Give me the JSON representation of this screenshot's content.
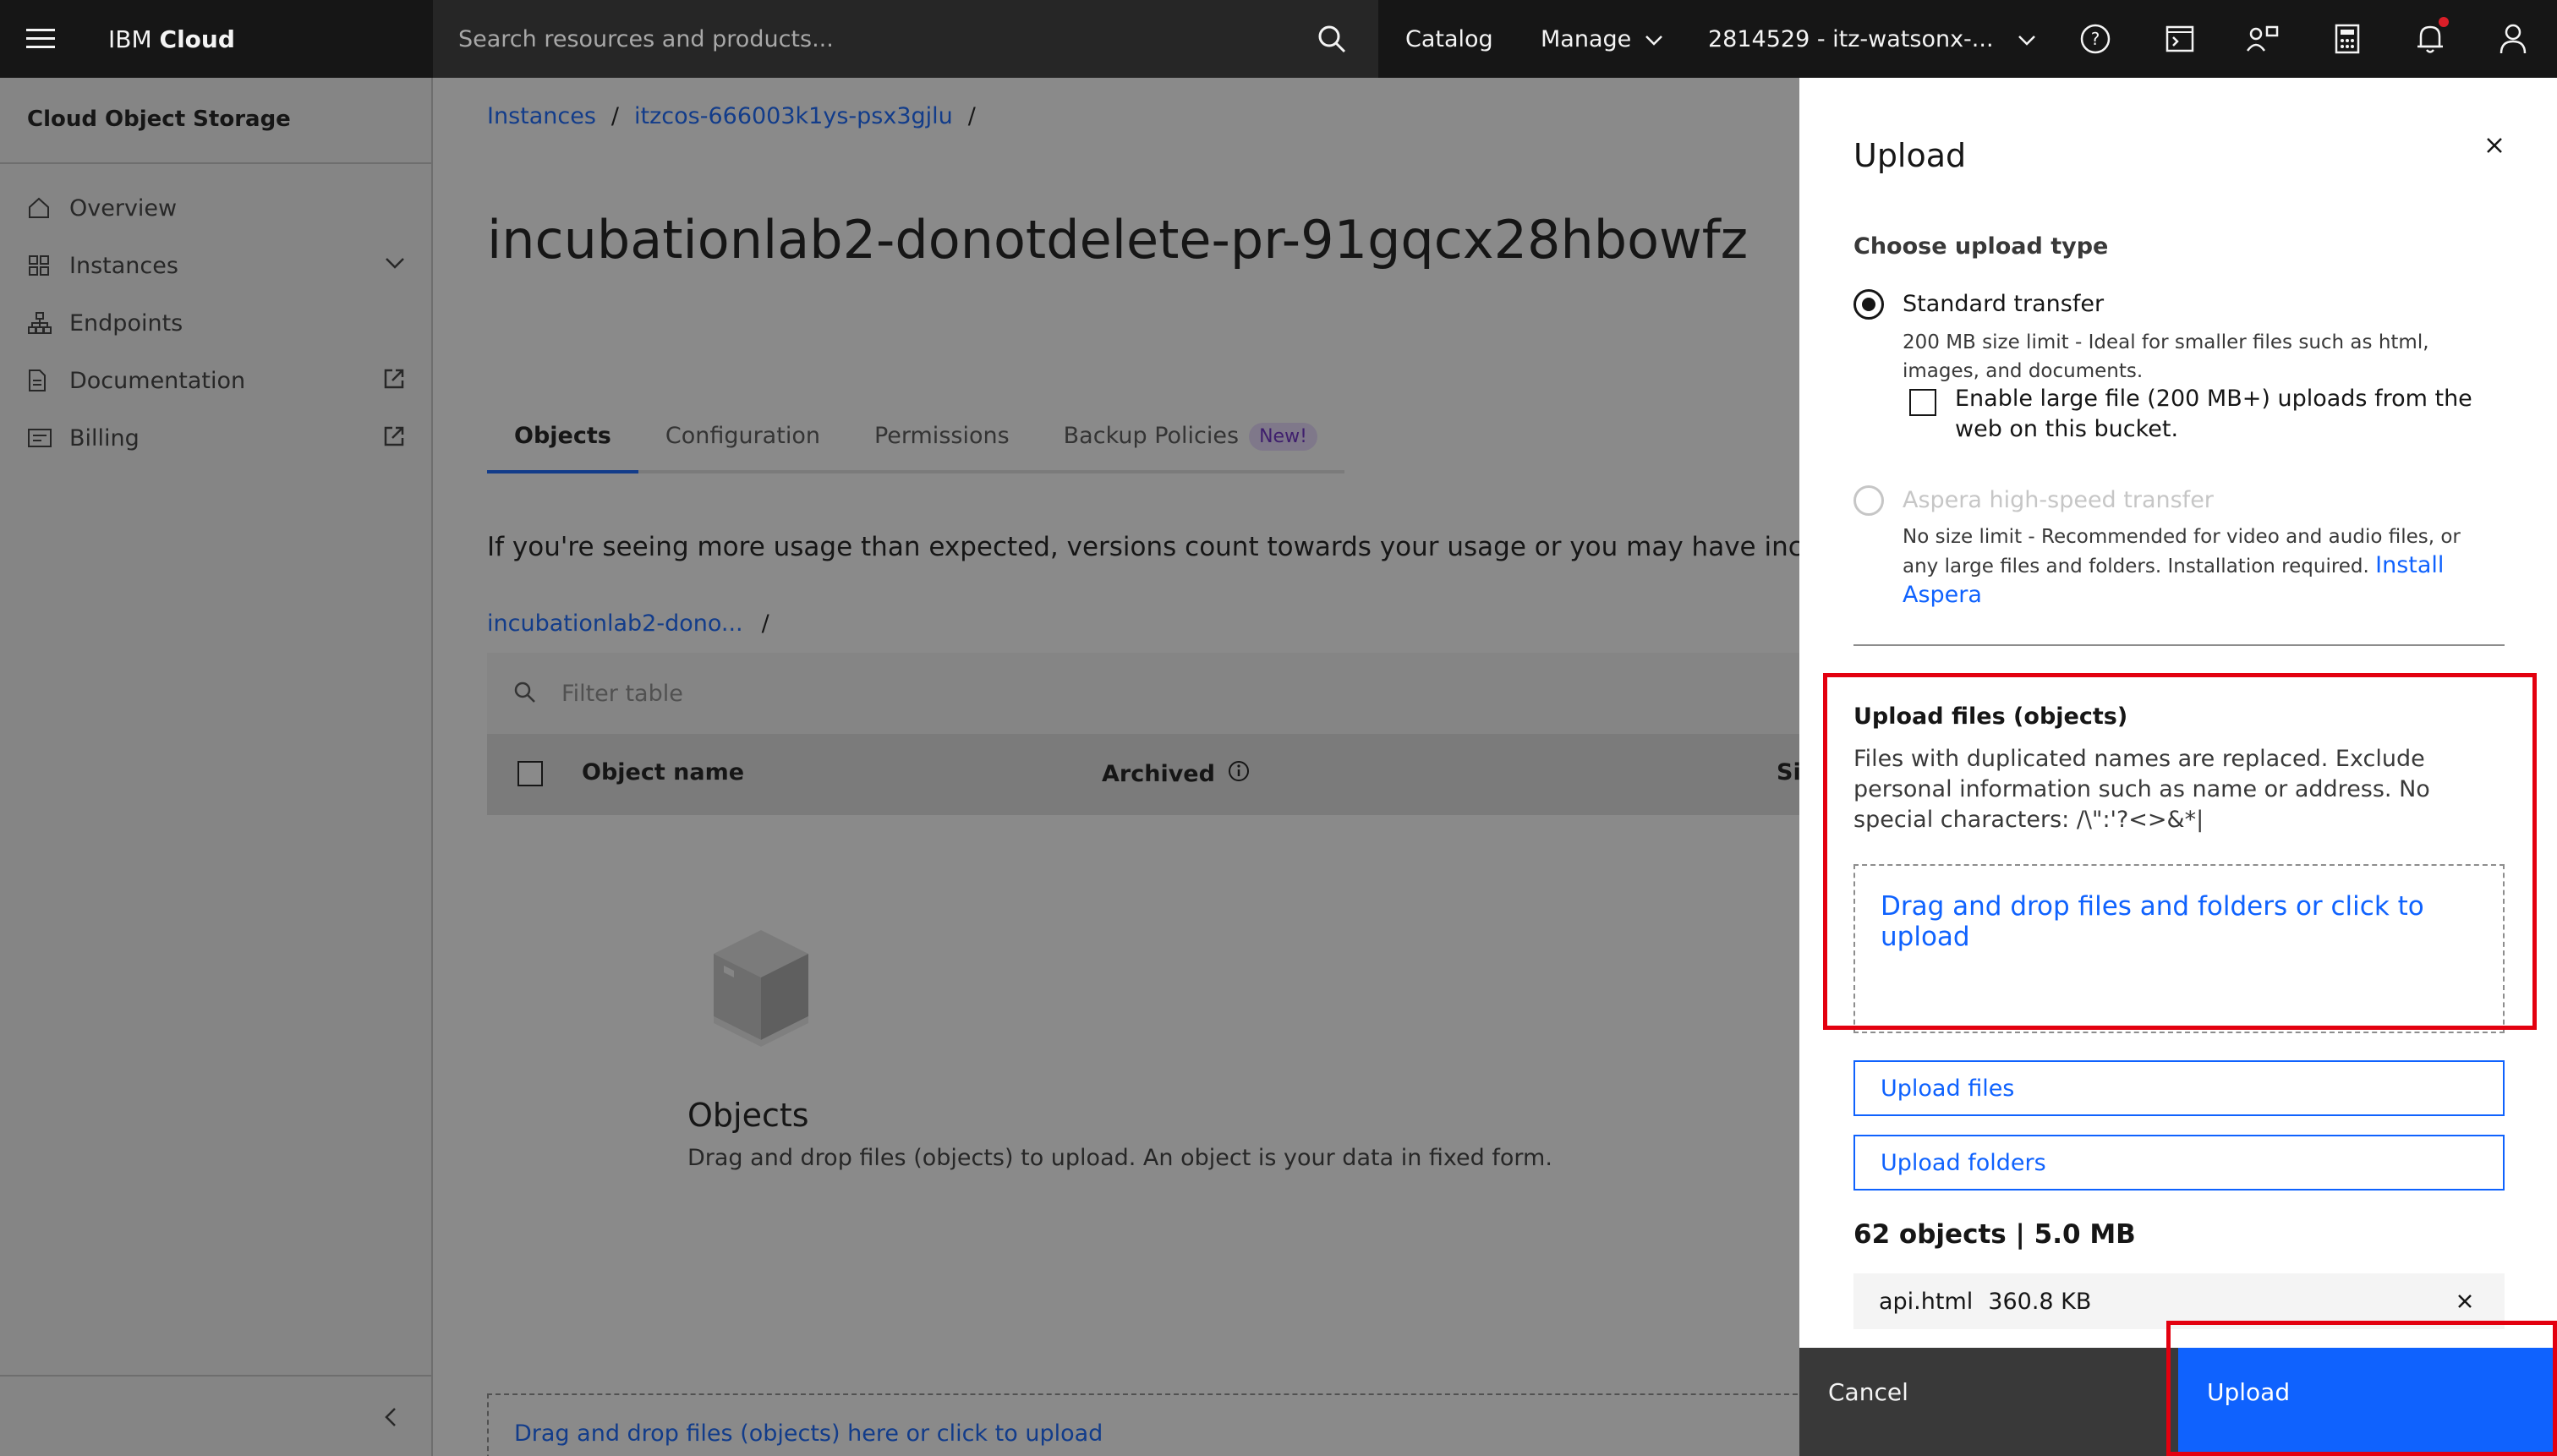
{
  "header": {
    "brand_light": "IBM",
    "brand_bold": "Cloud",
    "search_placeholder": "Search resources and products...",
    "nav": [
      "Catalog",
      "Manage",
      "2814529 - itz-watsonx-..."
    ]
  },
  "sidebar": {
    "title": "Cloud Object Storage",
    "items": [
      {
        "label": "Overview",
        "icon": "home-icon"
      },
      {
        "label": "Instances",
        "icon": "grid-icon"
      },
      {
        "label": "Endpoints",
        "icon": "network-icon"
      },
      {
        "label": "Documentation",
        "icon": "document-icon"
      },
      {
        "label": "Billing",
        "icon": "billing-icon"
      }
    ]
  },
  "main": {
    "breadcrumb": [
      "Instances",
      "itzcos-666003k1ys-psx3gjlu"
    ],
    "breadcrumb_separator": "/",
    "title": "incubationlab2-donotdelete-pr-91gqcx28hbowfz",
    "tabs": [
      "Objects",
      "Configuration",
      "Permissions",
      "Backup Policies"
    ],
    "tab_badge": "New!",
    "notice": "If you're seeing more usage than expected, versions count towards your usage or you may have incomplete uploads",
    "bucket_crumb": "incubationlab2-dono...",
    "filter_placeholder": "Filter table",
    "columns": [
      "Object name",
      "Archived",
      "Size"
    ],
    "empty_title": "Objects",
    "empty_desc": "Drag and drop files (objects) to upload. An object is your data in fixed form.",
    "dropzone": "Drag and drop files (objects) here or click to upload"
  },
  "panel": {
    "title": "Upload",
    "choose_label": "Choose upload type",
    "standard_title": "Standard transfer",
    "standard_desc": "200 MB size limit - Ideal for smaller files such as html, images, and documents.",
    "large_file_label": "Enable large file (200 MB+) uploads from the web on this bucket.",
    "aspera_title": "Aspera high-speed transfer",
    "aspera_desc": "No size limit - Recommended for video and audio files, or any large files and folders. Installation required.",
    "aspera_link": "Install Aspera",
    "upload_files_title": "Upload files (objects)",
    "upload_files_desc": "Files with duplicated names are replaced. Exclude personal information such as name or address. No special characters: /\\\":'?<>&*|",
    "drop_text": "Drag and drop files and folders or click to upload",
    "btn_upload_files": "Upload files",
    "btn_upload_folders": "Upload folders",
    "object_count": "62 objects | 5.0 MB",
    "file_name": "api.html",
    "file_size": "360.8 KB",
    "cancel": "Cancel",
    "upload": "Upload"
  },
  "colors": {
    "accent": "#0f62fe",
    "highlight": "#e3000f",
    "header_bg": "#161616"
  }
}
